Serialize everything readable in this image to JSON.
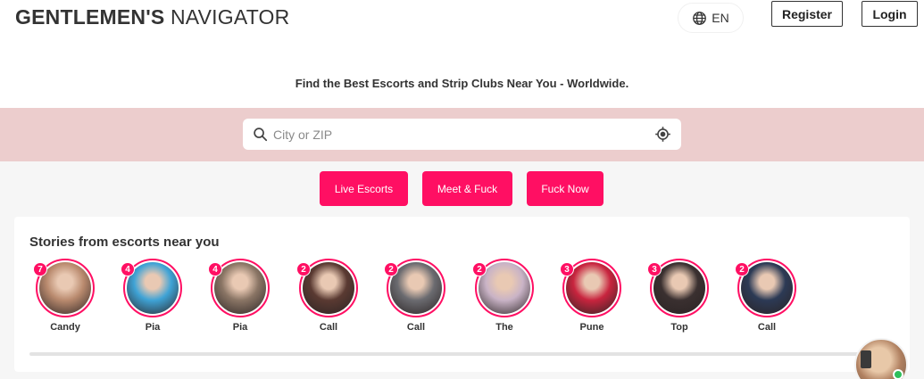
{
  "header": {
    "brand_bold": "GENTLEMEN'S",
    "brand_light": "NAVIGATOR",
    "language": "EN",
    "register_label": "Register",
    "login_label": "Login"
  },
  "tagline": "Find the Best Escorts and Strip Clubs Near You - Worldwide.",
  "search": {
    "placeholder": "City or ZIP",
    "value": ""
  },
  "categories": [
    {
      "label": "Live Escorts"
    },
    {
      "label": "Meet & Fuck"
    },
    {
      "label": "Fuck Now"
    }
  ],
  "stories": {
    "title": "Stories from escorts near you",
    "items": [
      {
        "name": "Candy",
        "count": "7",
        "tone": "#b98a6e"
      },
      {
        "name": "Pia",
        "count": "4",
        "tone": "#3fa3d6"
      },
      {
        "name": "Pia",
        "count": "4",
        "tone": "#8a7565"
      },
      {
        "name": "Call",
        "count": "2",
        "tone": "#5a3a32"
      },
      {
        "name": "Call",
        "count": "2",
        "tone": "#6b6b70"
      },
      {
        "name": "The",
        "count": "2",
        "tone": "#c9b3c6"
      },
      {
        "name": "Pune",
        "count": "3",
        "tone": "#c8243e"
      },
      {
        "name": "Top",
        "count": "3",
        "tone": "#3a3030"
      },
      {
        "name": "Call",
        "count": "2",
        "tone": "#2c3a55"
      }
    ]
  },
  "colors": {
    "accent": "#ff0f63",
    "search_band": "#eccdcd",
    "online": "#2fbf5b"
  },
  "icons": {
    "language": "globe-icon",
    "search": "search-icon",
    "locate": "crosshair-icon"
  }
}
